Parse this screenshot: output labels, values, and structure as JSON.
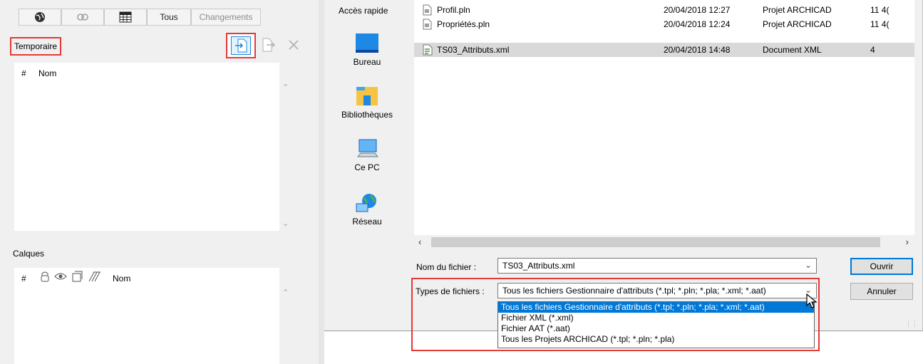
{
  "left_panel": {
    "tabs": [
      {
        "icon": "globe-icon"
      },
      {
        "icon": "link-icon"
      },
      {
        "icon": "grid-table-icon"
      },
      {
        "label": "Tous"
      },
      {
        "label": "Changements"
      }
    ],
    "temporaire_label": "Temporaire",
    "temp_list": {
      "columns": [
        "#",
        "Nom"
      ]
    },
    "calques_label": "Calques",
    "calques_list": {
      "columns": [
        "#",
        "Nom"
      ],
      "column_icons": [
        "lock-icon",
        "eye-icon",
        "layer-icon",
        "hatch-icon"
      ]
    }
  },
  "dialog": {
    "quick_access_label": "Accès rapide",
    "nav_items": [
      {
        "label": "Bureau",
        "icon": "desktop-icon"
      },
      {
        "label": "Bibliothèques",
        "icon": "libraries-icon"
      },
      {
        "label": "Ce PC",
        "icon": "computer-icon"
      },
      {
        "label": "Réseau",
        "icon": "network-icon"
      }
    ],
    "files": [
      {
        "name": "Profil.pln",
        "date": "20/04/2018 12:27",
        "type": "Projet ARCHICAD",
        "size": "11 4(",
        "selected": false
      },
      {
        "name": "Propriétés.pln",
        "date": "20/04/2018 12:24",
        "type": "Projet ARCHICAD",
        "size": "11 4(",
        "selected": false
      },
      {
        "name": "TS03_Attributs.xml",
        "date": "20/04/2018 14:48",
        "type": "Document XML",
        "size": "4",
        "selected": true
      }
    ],
    "filename_label": "Nom du fichier :",
    "filename_value": "TS03_Attributs.xml",
    "filetype_label": "Types de fichiers :",
    "filetype_value": "Tous les fichiers Gestionnaire d'attributs (*.tpl; *.pln; *.pla; *.xml; *.aat)",
    "filetype_options": [
      "Tous les fichiers Gestionnaire d'attributs (*.tpl; *.pln; *.pla; *.xml; *.aat)",
      "Fichier XML (*.xml)",
      "Fichier AAT (*.aat)",
      "Tous les Projets ARCHICAD (*.tpl; *.pln; *.pla)"
    ],
    "open_button": "Ouvrir",
    "cancel_button": "Annuler"
  },
  "colors": {
    "highlight_red": "#e53935",
    "selection_blue": "#0078d7"
  }
}
